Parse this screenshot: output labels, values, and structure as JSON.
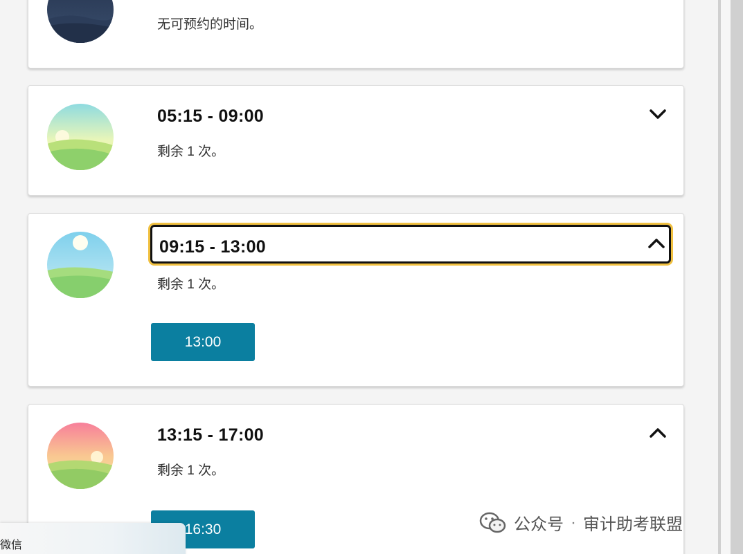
{
  "slots": [
    {
      "avatar": "night-scene-icon",
      "title": "",
      "subtitle": "无可预约的时间。",
      "buttons": []
    },
    {
      "avatar": "morning-scene-icon",
      "title": "05:15 - 09:00",
      "subtitle": "剩余 1 次。",
      "chevron": "chevron-down-icon",
      "expanded": false,
      "buttons": []
    },
    {
      "avatar": "midday-scene-icon",
      "title": "09:15 - 13:00",
      "subtitle": "剩余 1 次。",
      "chevron": "chevron-up-icon",
      "expanded": true,
      "focused": true,
      "buttons": [
        "13:00"
      ]
    },
    {
      "avatar": "sunset-scene-icon",
      "title": "13:15 - 17:00",
      "subtitle": "剩余 1 次。",
      "chevron": "chevron-up-icon",
      "expanded": true,
      "buttons": [
        "16:30"
      ]
    }
  ],
  "colors": {
    "button": "#0b7fa0",
    "focus_ring": "#f0c040"
  },
  "overlay": {
    "wechat_label": "微信",
    "watermark_prefix": "公众号",
    "watermark_name": "审计助考联盟"
  }
}
